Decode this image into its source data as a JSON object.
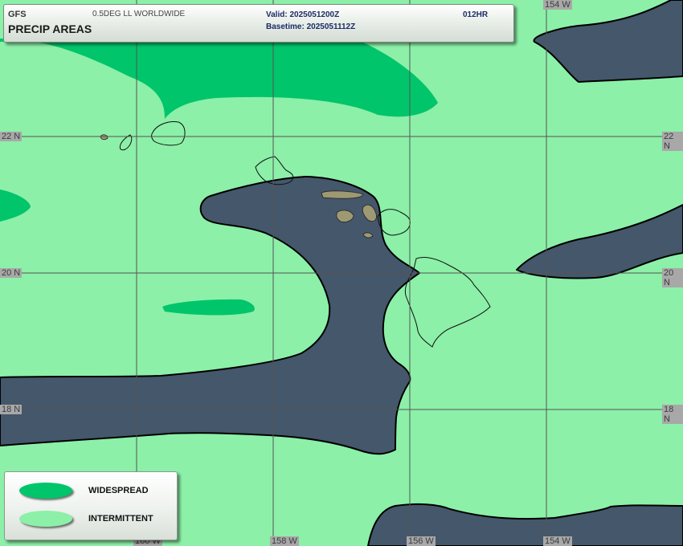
{
  "header": {
    "model": "GFS",
    "product": "PRECIP AREAS",
    "grid": "0.5DEG LL WORLDWIDE",
    "valid": "Valid: 2025051200Z",
    "basetime": "Basetime: 2025051112Z",
    "forecast_hour": "012HR"
  },
  "map": {
    "lon_labels": [
      "160 W",
      "158 W",
      "156 W",
      "154 W"
    ],
    "lat_labels": [
      "22 N",
      "20 N",
      "18 N"
    ]
  },
  "legend": {
    "items": [
      {
        "label": "WIDESPREAD",
        "color": "#00c56a"
      },
      {
        "label": "INTERMITTENT",
        "color": "#8cf0a8"
      }
    ]
  },
  "colors": {
    "intermittent": "#8cf0a8",
    "widespread": "#00c56a",
    "no_precip": "#44576b",
    "land": "#9d9a73"
  }
}
